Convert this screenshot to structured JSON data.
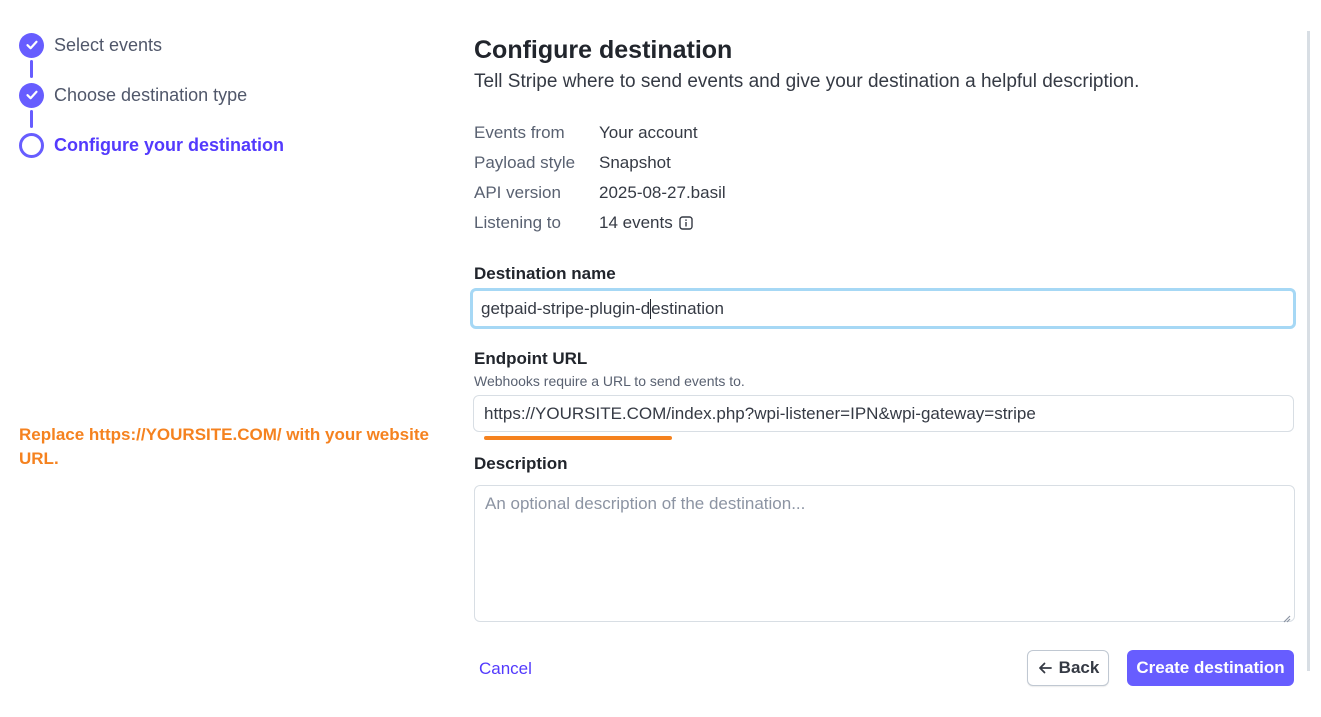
{
  "stepper": {
    "steps": [
      {
        "label": "Select events",
        "state": "done"
      },
      {
        "label": "Choose destination type",
        "state": "done"
      },
      {
        "label": "Configure your destination",
        "state": "current"
      }
    ]
  },
  "note": "Replace https://YOURSITE.COM/ with your website URL.",
  "main": {
    "title": "Configure destination",
    "subtitle": "Tell Stripe where to send events and give your destination a helpful description.",
    "meta": [
      {
        "key": "Events from",
        "value": "Your account"
      },
      {
        "key": "Payload style",
        "value": "Snapshot"
      },
      {
        "key": "API version",
        "value": "2025-08-27.basil"
      },
      {
        "key": "Listening to",
        "value": "14 events"
      }
    ],
    "destination_name": {
      "label": "Destination name",
      "value_before_caret": "getpaid-stripe-plugin-d",
      "value_after_caret": "estination"
    },
    "endpoint_url": {
      "label": "Endpoint URL",
      "help": "Webhooks require a URL to send events to.",
      "value": "https://YOURSITE.COM/index.php?wpi-listener=IPN&wpi-gateway=stripe"
    },
    "description": {
      "label": "Description",
      "placeholder": "An optional description of the destination..."
    }
  },
  "footer": {
    "cancel_label": "Cancel",
    "back_label": "Back",
    "create_label": "Create destination"
  },
  "colors": {
    "accent": "#675dff",
    "accent_text": "#533afd",
    "note": "#f5821f",
    "focus_ring": "#a6d8f5"
  }
}
